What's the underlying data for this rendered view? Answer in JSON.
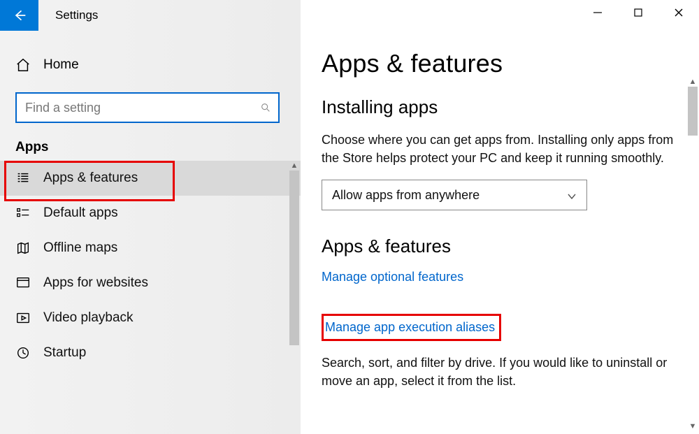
{
  "window": {
    "title": "Settings"
  },
  "sidebar": {
    "home_label": "Home",
    "search_placeholder": "Find a setting",
    "section_label": "Apps",
    "items": [
      {
        "label": "Apps & features",
        "icon": "apps-features-icon",
        "selected": true
      },
      {
        "label": "Default apps",
        "icon": "default-apps-icon",
        "selected": false
      },
      {
        "label": "Offline maps",
        "icon": "offline-maps-icon",
        "selected": false
      },
      {
        "label": "Apps for websites",
        "icon": "apps-websites-icon",
        "selected": false
      },
      {
        "label": "Video playback",
        "icon": "video-playback-icon",
        "selected": false
      },
      {
        "label": "Startup",
        "icon": "startup-icon",
        "selected": false
      }
    ]
  },
  "main": {
    "page_title": "Apps & features",
    "section1_title": "Installing apps",
    "section1_body": "Choose where you can get apps from. Installing only apps from the Store helps protect your PC and keep it running smoothly.",
    "dropdown_value": "Allow apps from anywhere",
    "section2_title": "Apps & features",
    "link_optional": "Manage optional features",
    "link_aliases": "Manage app execution aliases",
    "section2_body": "Search, sort, and filter by drive. If you would like to uninstall or move an app, select it from the list."
  }
}
